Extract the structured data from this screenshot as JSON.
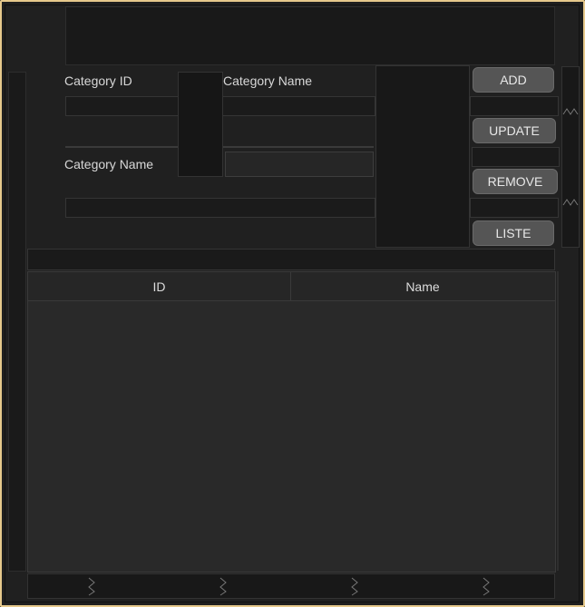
{
  "form": {
    "category_id_label": "Category ID",
    "category_name_label": "Category Name",
    "category_name_label_2": "Category Name"
  },
  "buttons": {
    "add": "ADD",
    "update": "UPDATE",
    "remove": "REMOVE",
    "liste": "LISTE"
  },
  "table": {
    "columns": [
      "ID",
      "Name"
    ],
    "rows": []
  },
  "colors": {
    "window_border": "#e6c98c",
    "background": "#1f1f1f",
    "button_bg": "#555555"
  }
}
